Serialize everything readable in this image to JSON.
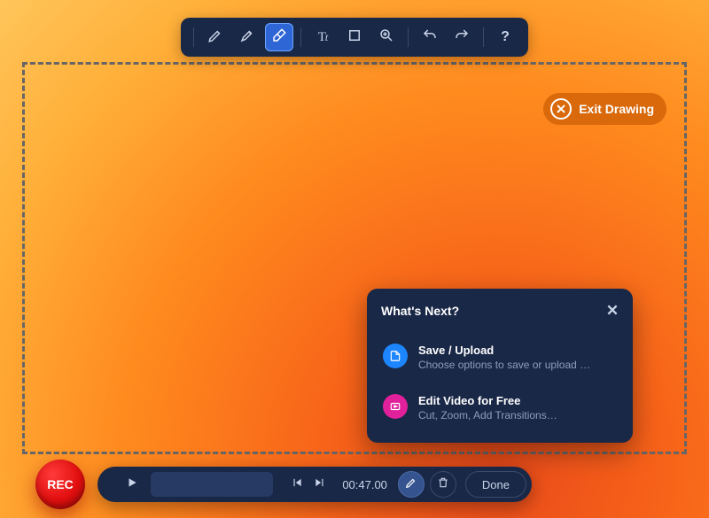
{
  "toolbar": {
    "tools": [
      "pen",
      "highlighter",
      "eraser",
      "text",
      "rectangle",
      "zoom",
      "undo",
      "redo",
      "help"
    ],
    "active": "eraser"
  },
  "exit_drawing": {
    "label": "Exit Drawing"
  },
  "popup": {
    "title": "What's Next?",
    "items": [
      {
        "title": "Save / Upload",
        "subtitle": "Choose options to save or upload …"
      },
      {
        "title": "Edit Video for Free",
        "subtitle": "Cut, Zoom, Add Transitions…"
      }
    ]
  },
  "controls": {
    "timecode": "00:47.00",
    "done_label": "Done",
    "rec_label": "REC"
  },
  "colors": {
    "panel": "#1a2847",
    "accent": "#2e66d6",
    "rec": "#e20f0f"
  }
}
